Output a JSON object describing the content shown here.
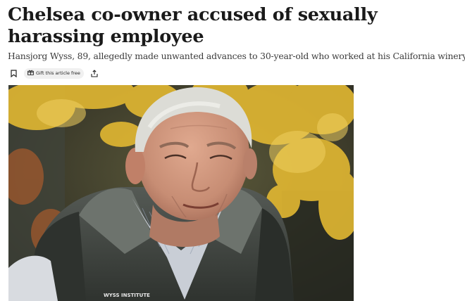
{
  "article": {
    "headline": "Chelsea co-owner accused of sexually harassing employee",
    "standfirst": "Hansjorg Wyss, 89, allegedly made unwanted advances to 30-year-old who worked at his California winery",
    "actions": {
      "save_icon": "bookmark-icon",
      "gift_icon": "gift-icon",
      "gift_label": "Gift this article free",
      "share_icon": "share-icon"
    },
    "photo": {
      "jacket_text": "WYSS INSTITUTE"
    }
  }
}
